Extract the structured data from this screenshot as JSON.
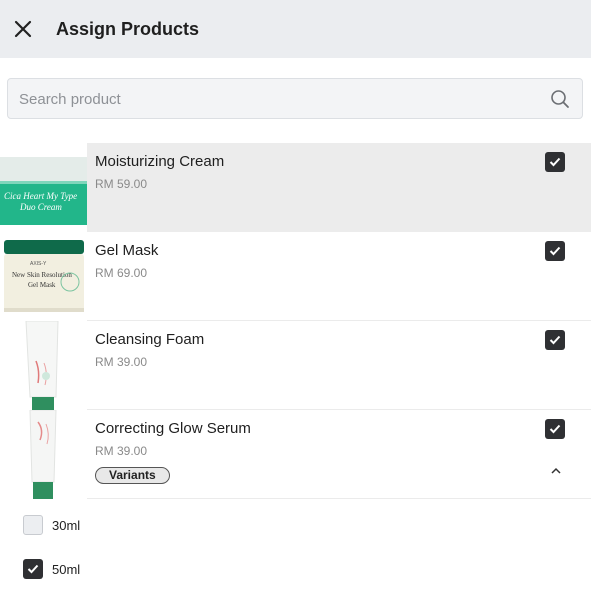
{
  "header": {
    "title": "Assign Products",
    "close_icon": "close-icon"
  },
  "search": {
    "placeholder": "Search product",
    "value": "",
    "icon": "search-icon"
  },
  "products": [
    {
      "name": "Moisturizing Cream",
      "price": "RM 59.00",
      "checked": true,
      "selected": true,
      "image_text": [
        "Cica Heart My Type",
        "Duo Cream"
      ]
    },
    {
      "name": "Gel Mask",
      "price": "RM 69.00",
      "checked": true,
      "image_text": [
        "AXIS-Y",
        "New Skin Resolution",
        "Gel Mask"
      ]
    },
    {
      "name": "Cleansing Foam",
      "price": "RM 39.00",
      "checked": true
    },
    {
      "name": "Correcting Glow Serum",
      "price": "RM 39.00",
      "checked": true,
      "variants_label": "Variants",
      "expanded": true
    }
  ],
  "variants": [
    {
      "label": "30ml",
      "checked": false
    },
    {
      "label": "50ml",
      "checked": true
    }
  ],
  "colors": {
    "header_bg": "#ebedf0",
    "checkbox": "#2f3033",
    "selected_row": "#ececec",
    "accent_green": "#2ea36b"
  }
}
